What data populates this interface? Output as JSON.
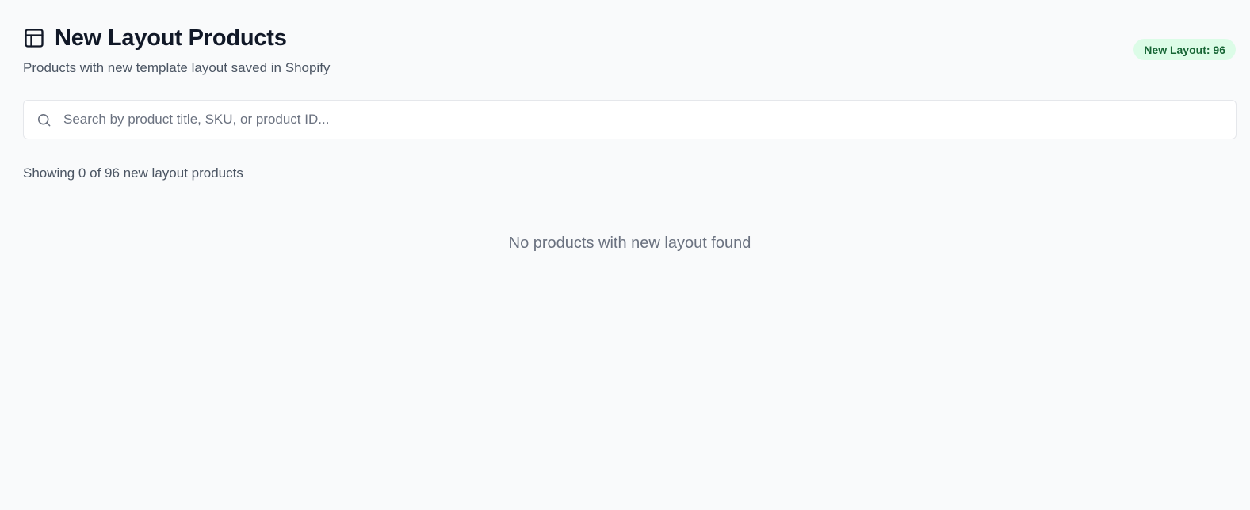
{
  "header": {
    "title": "New Layout Products",
    "title_icon": "layout-icon",
    "subtitle": "Products with new template layout saved in Shopify"
  },
  "badge": {
    "label": "New Layout: 96",
    "bg_color": "#dcfce7",
    "text_color": "#166534"
  },
  "search": {
    "icon": "search-icon",
    "placeholder": "Search by product title, SKU, or product ID...",
    "value": ""
  },
  "results": {
    "count_text": "Showing 0 of 96 new layout products",
    "empty_message": "No products with new layout found"
  }
}
